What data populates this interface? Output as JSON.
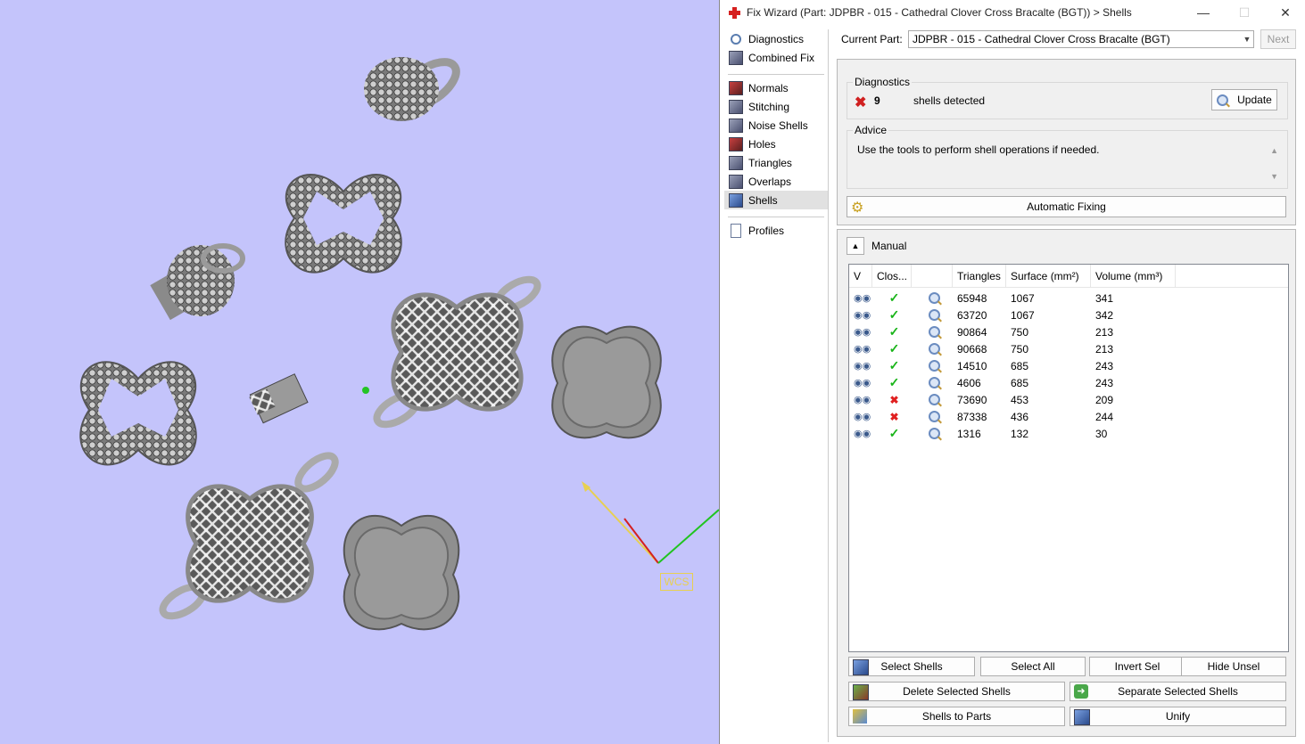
{
  "viewport": {
    "wcs_label": "WCS"
  },
  "window": {
    "title": "Fix Wizard (Part: JDPBR - 015 -  Cathedral Clover Cross  Bracalte (BGT)) > Shells",
    "minimize_icon": "minimize-icon",
    "maximize_icon": "maximize-icon",
    "close_icon": "close-icon"
  },
  "nav": {
    "items": [
      {
        "label": "Diagnostics",
        "icon": "magnifier-icon"
      },
      {
        "label": "Combined Fix",
        "icon": "cube-icon"
      },
      {
        "label": "Normals",
        "icon": "cube-red-icon"
      },
      {
        "label": "Stitching",
        "icon": "cube-icon"
      },
      {
        "label": "Noise Shells",
        "icon": "cube-icon"
      },
      {
        "label": "Holes",
        "icon": "cube-red-icon"
      },
      {
        "label": "Triangles",
        "icon": "cube-icon"
      },
      {
        "label": "Overlaps",
        "icon": "cube-icon"
      },
      {
        "label": "Shells",
        "icon": "cube-blue-icon"
      },
      {
        "label": "Profiles",
        "icon": "document-icon"
      }
    ],
    "active": "Shells"
  },
  "current_part": {
    "label": "Current Part:",
    "value": "JDPBR - 015 -  Cathedral Clover Cross  Bracalte (BGT)",
    "next_label": "Next"
  },
  "diagnostics": {
    "group_label": "Diagnostics",
    "count": "9",
    "status_text": "shells detected",
    "update_label": "Update"
  },
  "advice": {
    "group_label": "Advice",
    "text": "Use the tools to perform shell operations if needed."
  },
  "automatic_fixing_label": "Automatic Fixing",
  "manual": {
    "label": "Manual",
    "columns": [
      "V",
      "Clos...",
      "",
      "Triangles",
      "Surface (mm²)",
      "Volume (mm³)"
    ],
    "rows": [
      {
        "closed": true,
        "triangles": "65948",
        "surface": "1067",
        "volume": "341"
      },
      {
        "closed": true,
        "triangles": "63720",
        "surface": "1067",
        "volume": "342"
      },
      {
        "closed": true,
        "triangles": "90864",
        "surface": "750",
        "volume": "213"
      },
      {
        "closed": true,
        "triangles": "90668",
        "surface": "750",
        "volume": "213"
      },
      {
        "closed": true,
        "triangles": "14510",
        "surface": "685",
        "volume": "243"
      },
      {
        "closed": true,
        "triangles": "4606",
        "surface": "685",
        "volume": "243"
      },
      {
        "closed": false,
        "triangles": "73690",
        "surface": "453",
        "volume": "209"
      },
      {
        "closed": false,
        "triangles": "87338",
        "surface": "436",
        "volume": "244"
      },
      {
        "closed": true,
        "triangles": "1316",
        "surface": "132",
        "volume": "30"
      }
    ],
    "buttons": {
      "select_shells": "Select Shells",
      "select_all": "Select All",
      "invert_sel": "Invert Sel",
      "hide_unsel": "Hide Unsel",
      "delete_selected": "Delete Selected Shells",
      "separate_selected": "Separate Selected Shells",
      "shells_to_parts": "Shells to Parts",
      "unify": "Unify"
    }
  }
}
